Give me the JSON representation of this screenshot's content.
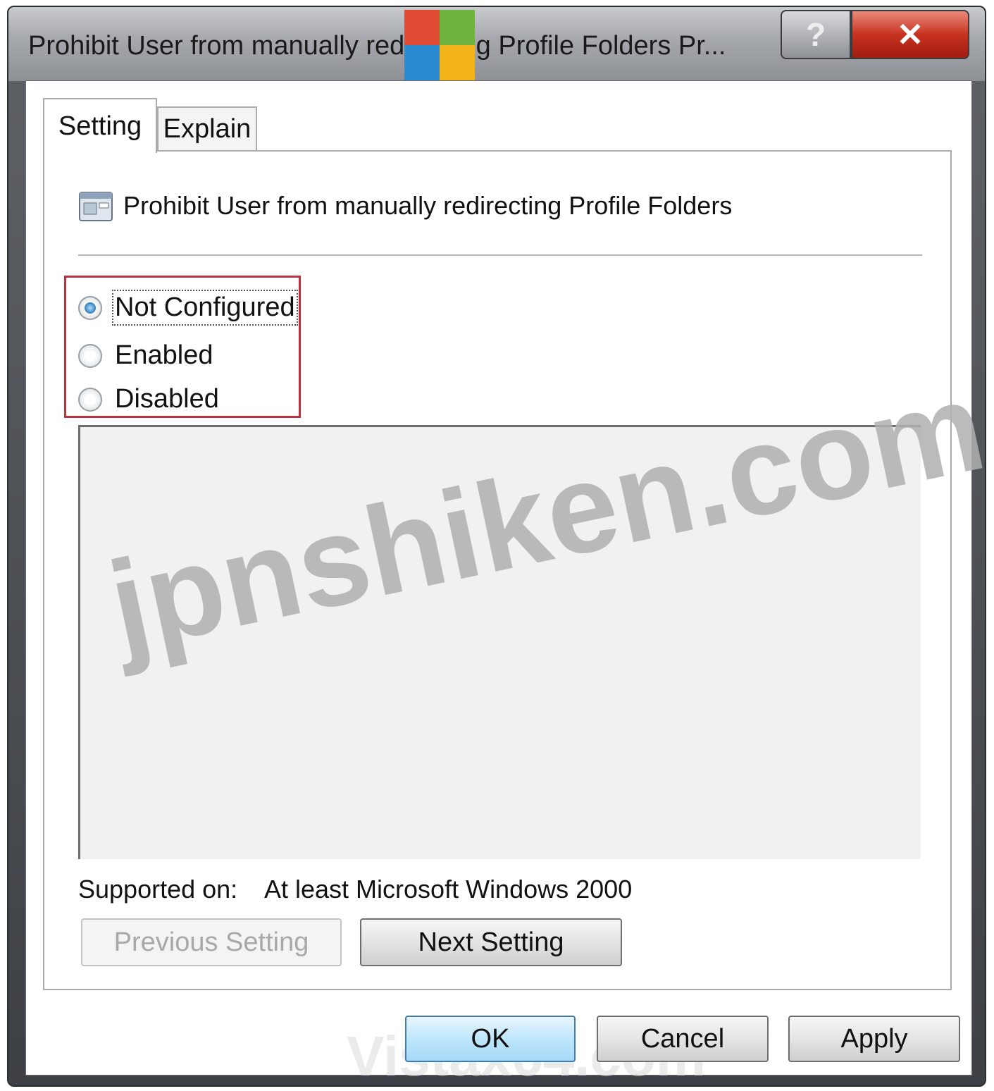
{
  "window": {
    "title": "Prohibit User from manually redirecting Profile Folders Pr...",
    "help_label": "?",
    "close_label": "✕"
  },
  "tabs": [
    {
      "label": "Setting",
      "active": true
    },
    {
      "label": "Explain",
      "active": false
    }
  ],
  "policy": {
    "title": "Prohibit User from manually redirecting Profile Folders",
    "icon": "policy-setting-icon"
  },
  "options": [
    {
      "label": "Not Configured",
      "checked": true
    },
    {
      "label": "Enabled",
      "checked": false
    },
    {
      "label": "Disabled",
      "checked": false
    }
  ],
  "supported": {
    "label": "Supported on:",
    "value": "At least Microsoft Windows 2000"
  },
  "nav_buttons": {
    "previous": "Previous Setting",
    "next": "Next Setting"
  },
  "dialog_buttons": {
    "ok": "OK",
    "cancel": "Cancel",
    "apply": "Apply"
  },
  "watermarks": {
    "main": "jpnshiken.com",
    "secondary": "Vistax64.com"
  },
  "colors": {
    "highlight_box": "#b8333f",
    "close_button": "#c7321f",
    "ok_button": "#bee6fd"
  }
}
